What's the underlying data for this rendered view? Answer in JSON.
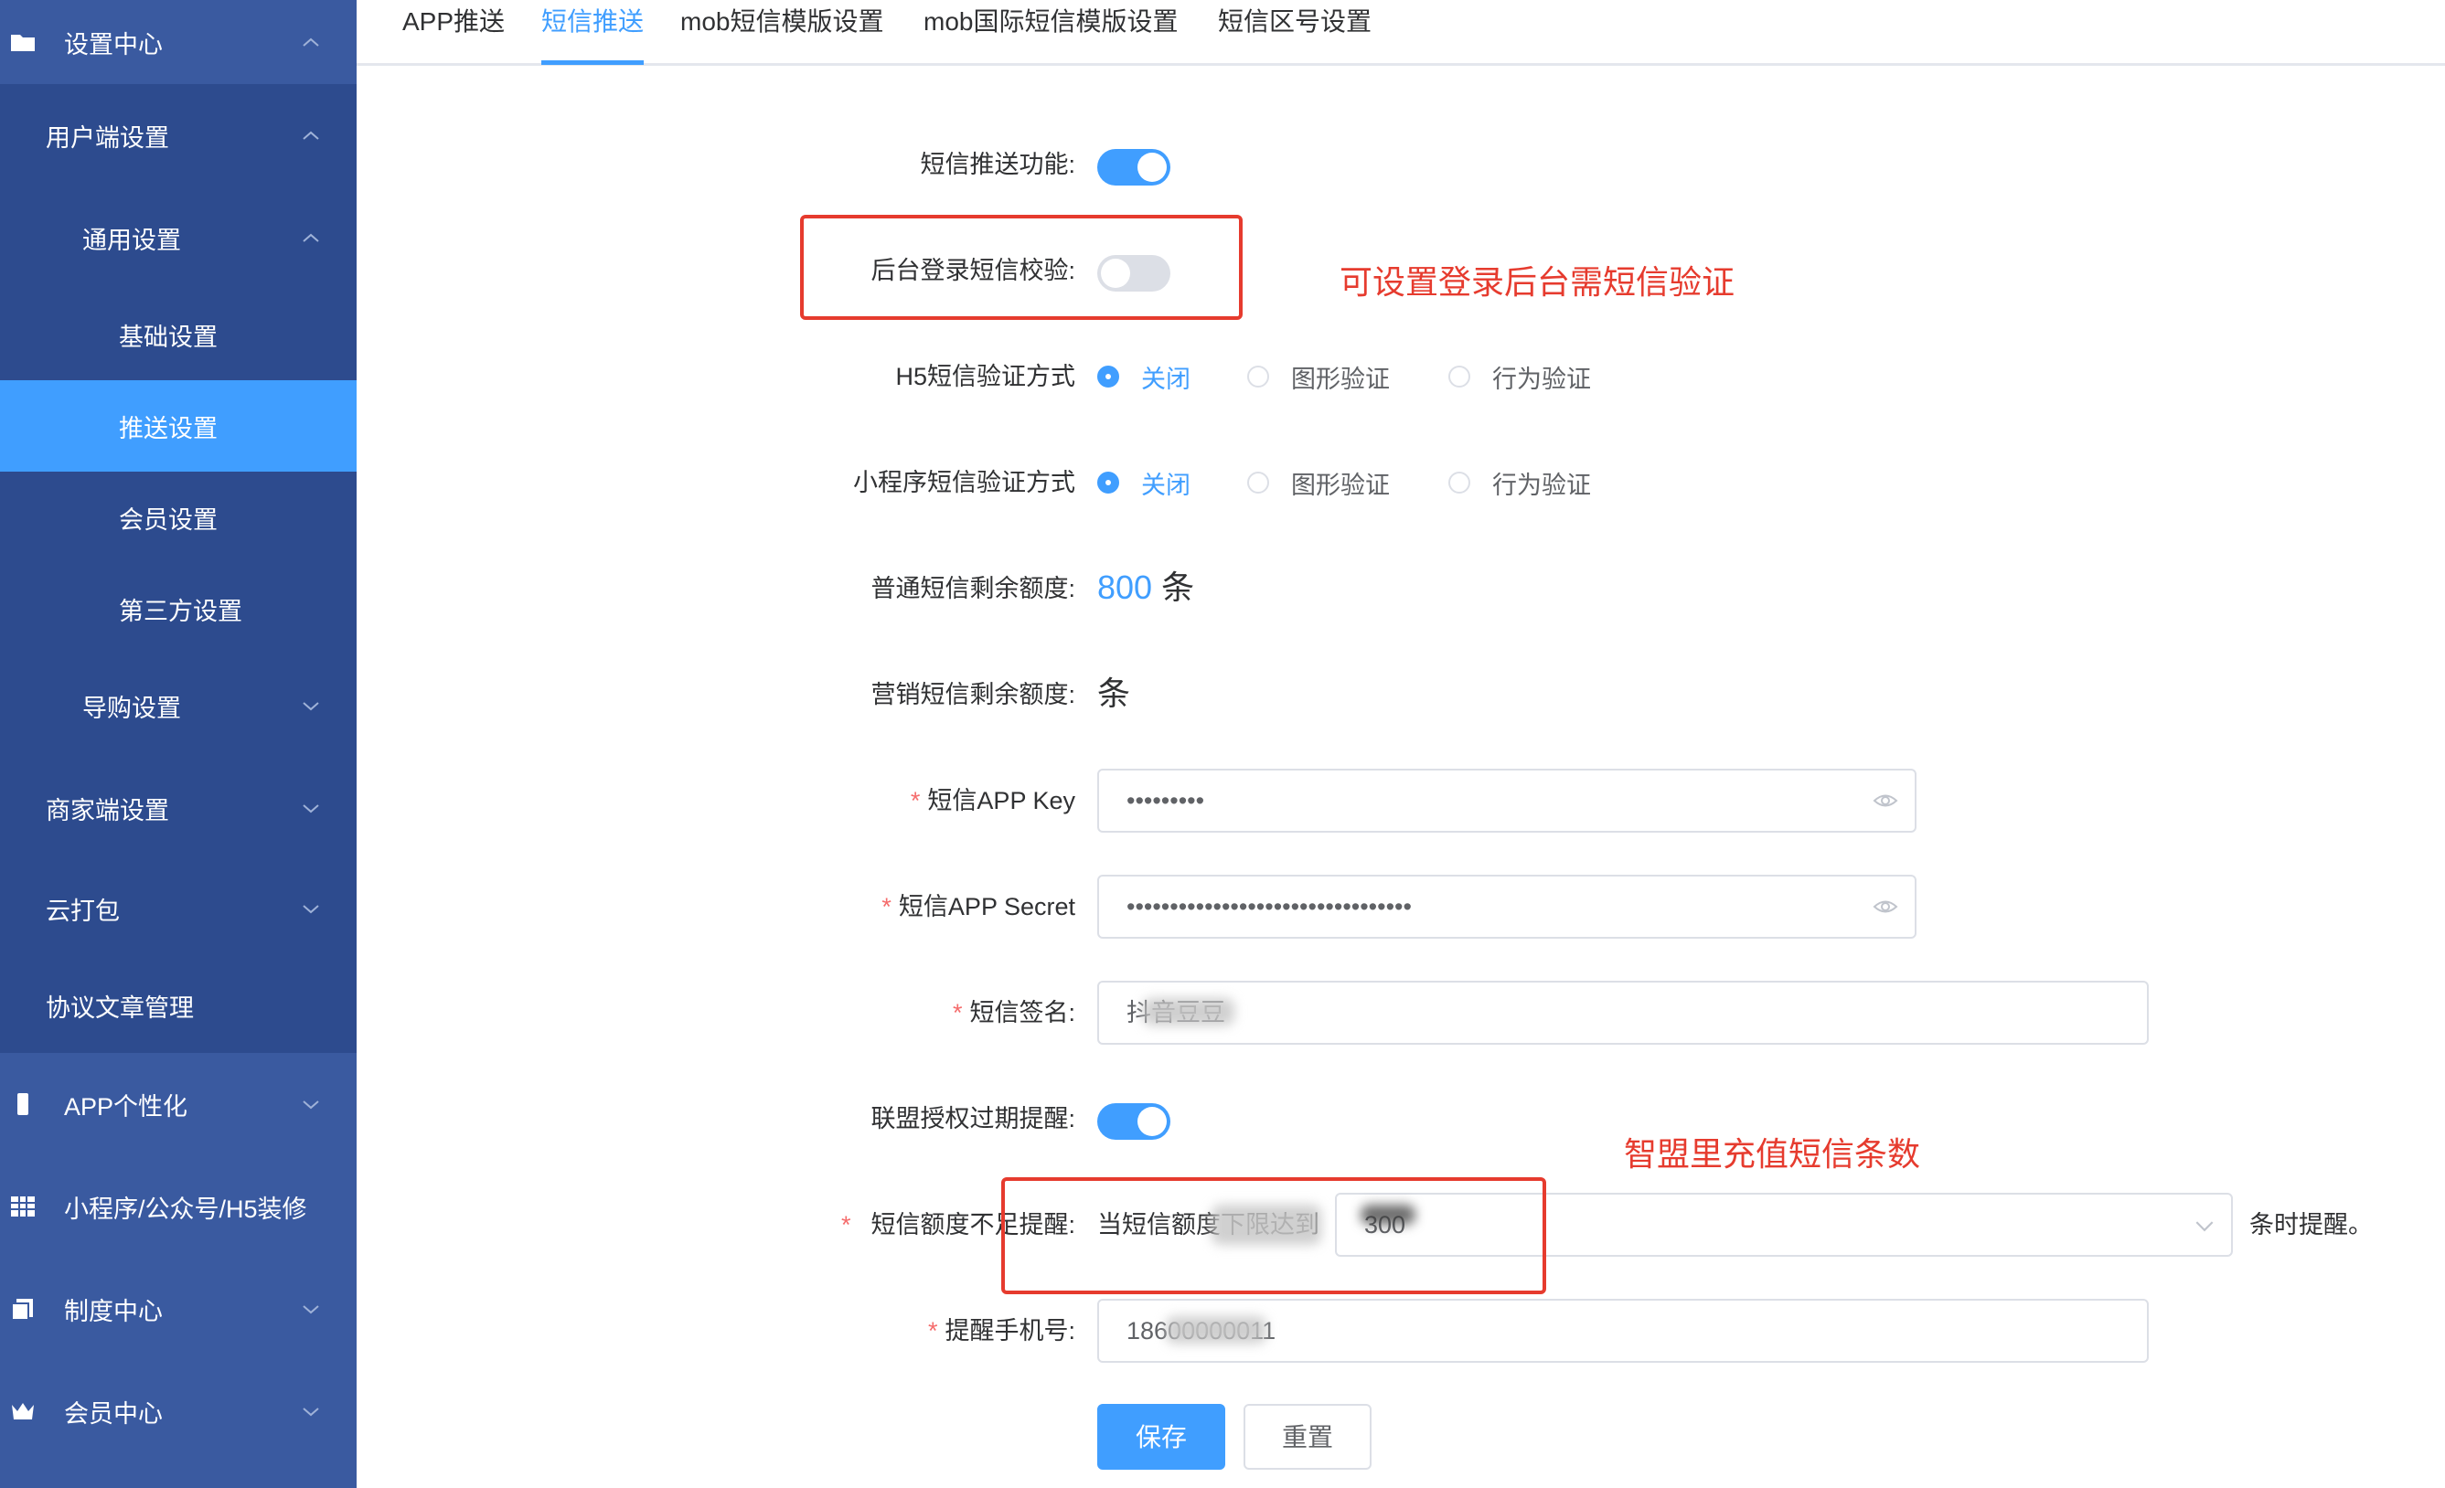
{
  "sidebar": {
    "items": [
      {
        "label": "设置中心",
        "icon": "folder-icon"
      },
      {
        "label": "用户端设置"
      },
      {
        "label": "通用设置"
      },
      {
        "label": "基础设置"
      },
      {
        "label": "推送设置"
      },
      {
        "label": "会员设置"
      },
      {
        "label": "第三方设置"
      },
      {
        "label": "导购设置"
      },
      {
        "label": "商家端设置"
      },
      {
        "label": "云打包"
      },
      {
        "label": "协议文章管理"
      },
      {
        "label": "APP个性化",
        "icon": "phone-icon"
      },
      {
        "label": "小程序/公众号/H5装修",
        "icon": "grid-icon"
      },
      {
        "label": "制度中心",
        "icon": "document-icon"
      },
      {
        "label": "会员中心",
        "icon": "crown-icon"
      }
    ]
  },
  "tabs": [
    {
      "label": "APP推送"
    },
    {
      "label": "短信推送"
    },
    {
      "label": "mob短信模版设置"
    },
    {
      "label": "mob国际短信模版设置"
    },
    {
      "label": "短信区号设置"
    }
  ],
  "form": {
    "sms_push_label": "短信推送功能:",
    "sms_push_enabled": true,
    "admin_login_label": "后台登录短信校验:",
    "admin_login_enabled": false,
    "h5_verify_label": "H5短信验证方式",
    "mini_verify_label": "小程序短信验证方式",
    "verify_options": [
      "关闭",
      "图形验证",
      "行为验证"
    ],
    "normal_balance_label": "普通短信剩余额度:",
    "normal_balance_value": "800",
    "unit": "条",
    "marketing_balance_label": "营销短信剩余额度:",
    "app_key_label": "短信APP Key",
    "app_key_value": "•••••••••",
    "app_secret_label": "短信APP Secret",
    "app_secret_value": "•••••••••••••••••••••••••••••••••",
    "signature_label": "短信签名:",
    "signature_value": "抖音豆豆",
    "alliance_label": "联盟授权过期提醒:",
    "alliance_enabled": true,
    "threshold_label": "短信额度不足提醒:",
    "threshold_prefix": "当短信额度下限达到",
    "threshold_value": "300",
    "threshold_suffix": "条时提醒。",
    "phone_label": "提醒手机号:",
    "phone_value": "18600000011",
    "save_label": "保存",
    "reset_label": "重置"
  },
  "annotations": {
    "note1": "可设置登录后台需短信验证",
    "note2": "智盟里充值短信条数"
  },
  "colors": {
    "sidebar_bg": "#2d4b8e",
    "sidebar_active": "#409eff",
    "primary": "#409eff",
    "annotation_red": "#e63b2e"
  }
}
